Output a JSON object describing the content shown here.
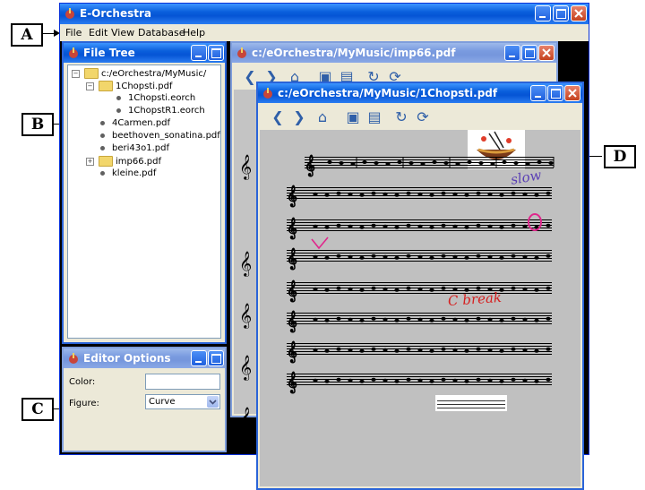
{
  "callouts": {
    "a": "A",
    "b": "B",
    "c": "C",
    "d": "D"
  },
  "app": {
    "title": "E-Orchestra"
  },
  "menu": [
    "File",
    "Edit",
    "View",
    "Database",
    "Help"
  ],
  "file_tree": {
    "title": "File Tree",
    "items": [
      {
        "label": "c:/eOrchestra/MyMusic/"
      },
      {
        "label": "1Chopsti.pdf"
      },
      {
        "label": "1Chopsti.eorch"
      },
      {
        "label": "1ChopstR1.eorch"
      },
      {
        "label": "4Carmen.pdf"
      },
      {
        "label": "beethoven_sonatina.pdf"
      },
      {
        "label": "beri43o1.pdf"
      },
      {
        "label": "imp66.pdf"
      },
      {
        "label": "kleine.pdf"
      }
    ]
  },
  "editor_options": {
    "title": "Editor Options",
    "color_label": "Color:",
    "figure_label": "Figure:",
    "figure_value": "Curve"
  },
  "doc_back": {
    "title": "c:/eOrchestra/MyMusic/imp66.pdf"
  },
  "doc_front": {
    "title": "c:/eOrchestra/MyMusic/1Chopsti.pdf",
    "annotations": {
      "slow": "slow",
      "break": "C break"
    }
  },
  "colors": {
    "title_active": "#0a5fdc",
    "annotation_blue": "#5a3fb5",
    "annotation_pink": "#e0268c",
    "annotation_red": "#d62020"
  }
}
